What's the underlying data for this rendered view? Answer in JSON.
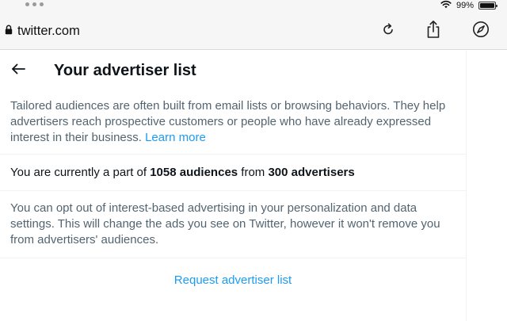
{
  "status_bar": {
    "battery_text": "99%",
    "battery_level": 0.99
  },
  "browser": {
    "address": "twitter.com"
  },
  "page": {
    "title": "Your advertiser list",
    "intro": "Tailored audiences are often built from email lists or browsing behaviors. They help advertisers reach prospective customers or people who have already expressed interest in their business.",
    "learn_more": "Learn more",
    "count": {
      "prefix": "You are currently a part of ",
      "audiences": "1058 audiences",
      "middle": " from ",
      "advertisers": "300 advertisers"
    },
    "optout": "You can opt out of interest-based advertising in your personalization and data settings. This will change the ads you see on Twitter, however it won't remove you from advertisers' audiences.",
    "request_button": "Request advertiser list"
  },
  "colors": {
    "accent": "#1d9bf0",
    "text_primary": "#0f1419",
    "text_secondary": "#536471"
  },
  "icons": [
    "wifi-icon",
    "battery-icon",
    "lock-icon",
    "reload-icon",
    "share-icon",
    "compass-icon",
    "back-arrow-icon"
  ]
}
